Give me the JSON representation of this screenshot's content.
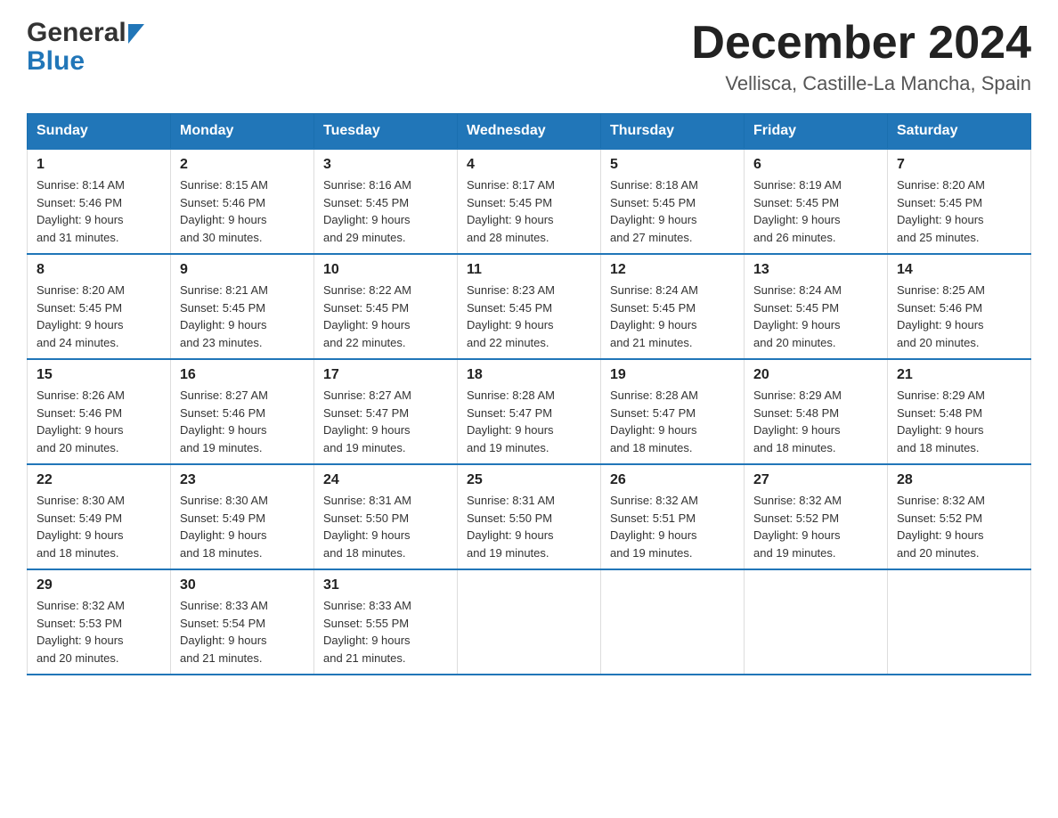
{
  "header": {
    "logo_line1": "General",
    "logo_line2": "Blue",
    "month_title": "December 2024",
    "location": "Vellisca, Castille-La Mancha, Spain"
  },
  "days_of_week": [
    "Sunday",
    "Monday",
    "Tuesday",
    "Wednesday",
    "Thursday",
    "Friday",
    "Saturday"
  ],
  "weeks": [
    [
      {
        "num": "1",
        "sunrise": "8:14 AM",
        "sunset": "5:46 PM",
        "daylight": "9 hours and 31 minutes."
      },
      {
        "num": "2",
        "sunrise": "8:15 AM",
        "sunset": "5:46 PM",
        "daylight": "9 hours and 30 minutes."
      },
      {
        "num": "3",
        "sunrise": "8:16 AM",
        "sunset": "5:45 PM",
        "daylight": "9 hours and 29 minutes."
      },
      {
        "num": "4",
        "sunrise": "8:17 AM",
        "sunset": "5:45 PM",
        "daylight": "9 hours and 28 minutes."
      },
      {
        "num": "5",
        "sunrise": "8:18 AM",
        "sunset": "5:45 PM",
        "daylight": "9 hours and 27 minutes."
      },
      {
        "num": "6",
        "sunrise": "8:19 AM",
        "sunset": "5:45 PM",
        "daylight": "9 hours and 26 minutes."
      },
      {
        "num": "7",
        "sunrise": "8:20 AM",
        "sunset": "5:45 PM",
        "daylight": "9 hours and 25 minutes."
      }
    ],
    [
      {
        "num": "8",
        "sunrise": "8:20 AM",
        "sunset": "5:45 PM",
        "daylight": "9 hours and 24 minutes."
      },
      {
        "num": "9",
        "sunrise": "8:21 AM",
        "sunset": "5:45 PM",
        "daylight": "9 hours and 23 minutes."
      },
      {
        "num": "10",
        "sunrise": "8:22 AM",
        "sunset": "5:45 PM",
        "daylight": "9 hours and 22 minutes."
      },
      {
        "num": "11",
        "sunrise": "8:23 AM",
        "sunset": "5:45 PM",
        "daylight": "9 hours and 22 minutes."
      },
      {
        "num": "12",
        "sunrise": "8:24 AM",
        "sunset": "5:45 PM",
        "daylight": "9 hours and 21 minutes."
      },
      {
        "num": "13",
        "sunrise": "8:24 AM",
        "sunset": "5:45 PM",
        "daylight": "9 hours and 20 minutes."
      },
      {
        "num": "14",
        "sunrise": "8:25 AM",
        "sunset": "5:46 PM",
        "daylight": "9 hours and 20 minutes."
      }
    ],
    [
      {
        "num": "15",
        "sunrise": "8:26 AM",
        "sunset": "5:46 PM",
        "daylight": "9 hours and 20 minutes."
      },
      {
        "num": "16",
        "sunrise": "8:27 AM",
        "sunset": "5:46 PM",
        "daylight": "9 hours and 19 minutes."
      },
      {
        "num": "17",
        "sunrise": "8:27 AM",
        "sunset": "5:47 PM",
        "daylight": "9 hours and 19 minutes."
      },
      {
        "num": "18",
        "sunrise": "8:28 AM",
        "sunset": "5:47 PM",
        "daylight": "9 hours and 19 minutes."
      },
      {
        "num": "19",
        "sunrise": "8:28 AM",
        "sunset": "5:47 PM",
        "daylight": "9 hours and 18 minutes."
      },
      {
        "num": "20",
        "sunrise": "8:29 AM",
        "sunset": "5:48 PM",
        "daylight": "9 hours and 18 minutes."
      },
      {
        "num": "21",
        "sunrise": "8:29 AM",
        "sunset": "5:48 PM",
        "daylight": "9 hours and 18 minutes."
      }
    ],
    [
      {
        "num": "22",
        "sunrise": "8:30 AM",
        "sunset": "5:49 PM",
        "daylight": "9 hours and 18 minutes."
      },
      {
        "num": "23",
        "sunrise": "8:30 AM",
        "sunset": "5:49 PM",
        "daylight": "9 hours and 18 minutes."
      },
      {
        "num": "24",
        "sunrise": "8:31 AM",
        "sunset": "5:50 PM",
        "daylight": "9 hours and 18 minutes."
      },
      {
        "num": "25",
        "sunrise": "8:31 AM",
        "sunset": "5:50 PM",
        "daylight": "9 hours and 19 minutes."
      },
      {
        "num": "26",
        "sunrise": "8:32 AM",
        "sunset": "5:51 PM",
        "daylight": "9 hours and 19 minutes."
      },
      {
        "num": "27",
        "sunrise": "8:32 AM",
        "sunset": "5:52 PM",
        "daylight": "9 hours and 19 minutes."
      },
      {
        "num": "28",
        "sunrise": "8:32 AM",
        "sunset": "5:52 PM",
        "daylight": "9 hours and 20 minutes."
      }
    ],
    [
      {
        "num": "29",
        "sunrise": "8:32 AM",
        "sunset": "5:53 PM",
        "daylight": "9 hours and 20 minutes."
      },
      {
        "num": "30",
        "sunrise": "8:33 AM",
        "sunset": "5:54 PM",
        "daylight": "9 hours and 21 minutes."
      },
      {
        "num": "31",
        "sunrise": "8:33 AM",
        "sunset": "5:55 PM",
        "daylight": "9 hours and 21 minutes."
      },
      null,
      null,
      null,
      null
    ]
  ]
}
